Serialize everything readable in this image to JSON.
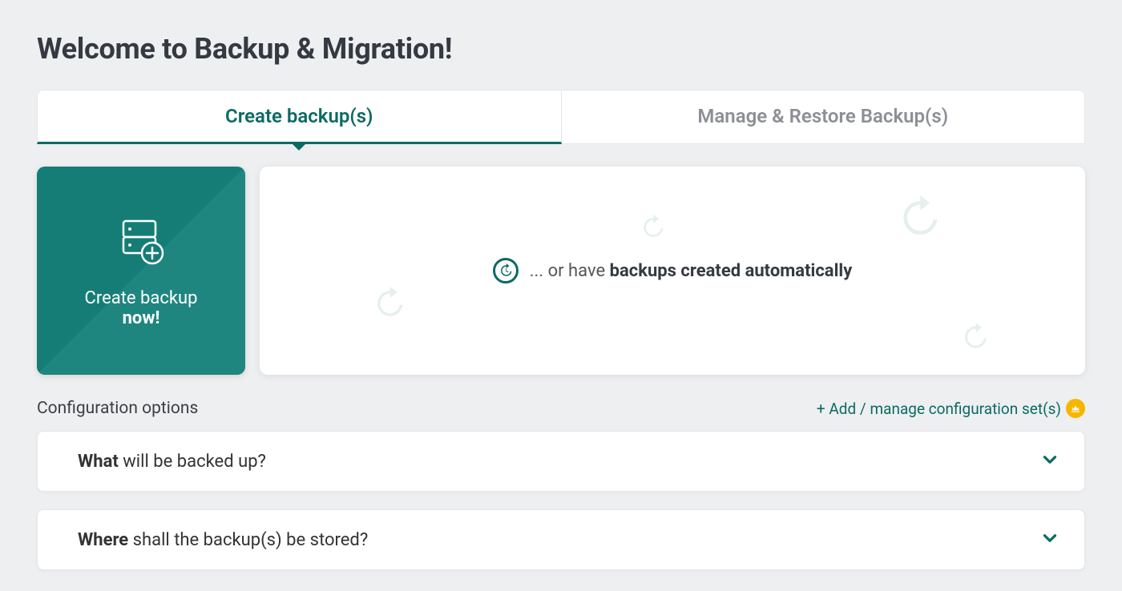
{
  "page": {
    "title": "Welcome to Backup & Migration!"
  },
  "tabs": {
    "create": "Create backup(s)",
    "manage": "Manage & Restore Backup(s)"
  },
  "actions": {
    "create_now_line1": "Create backup",
    "create_now_line2": "now!",
    "auto_prefix": "... or have ",
    "auto_strong": "backups created automatically"
  },
  "config": {
    "label": "Configuration options",
    "add_link": "+ Add / manage configuration set(s)"
  },
  "accordion": {
    "what_bold": "What",
    "what_rest": " will be backed up?",
    "where_bold": "Where",
    "where_rest": " shall the backup(s) be stored?"
  }
}
